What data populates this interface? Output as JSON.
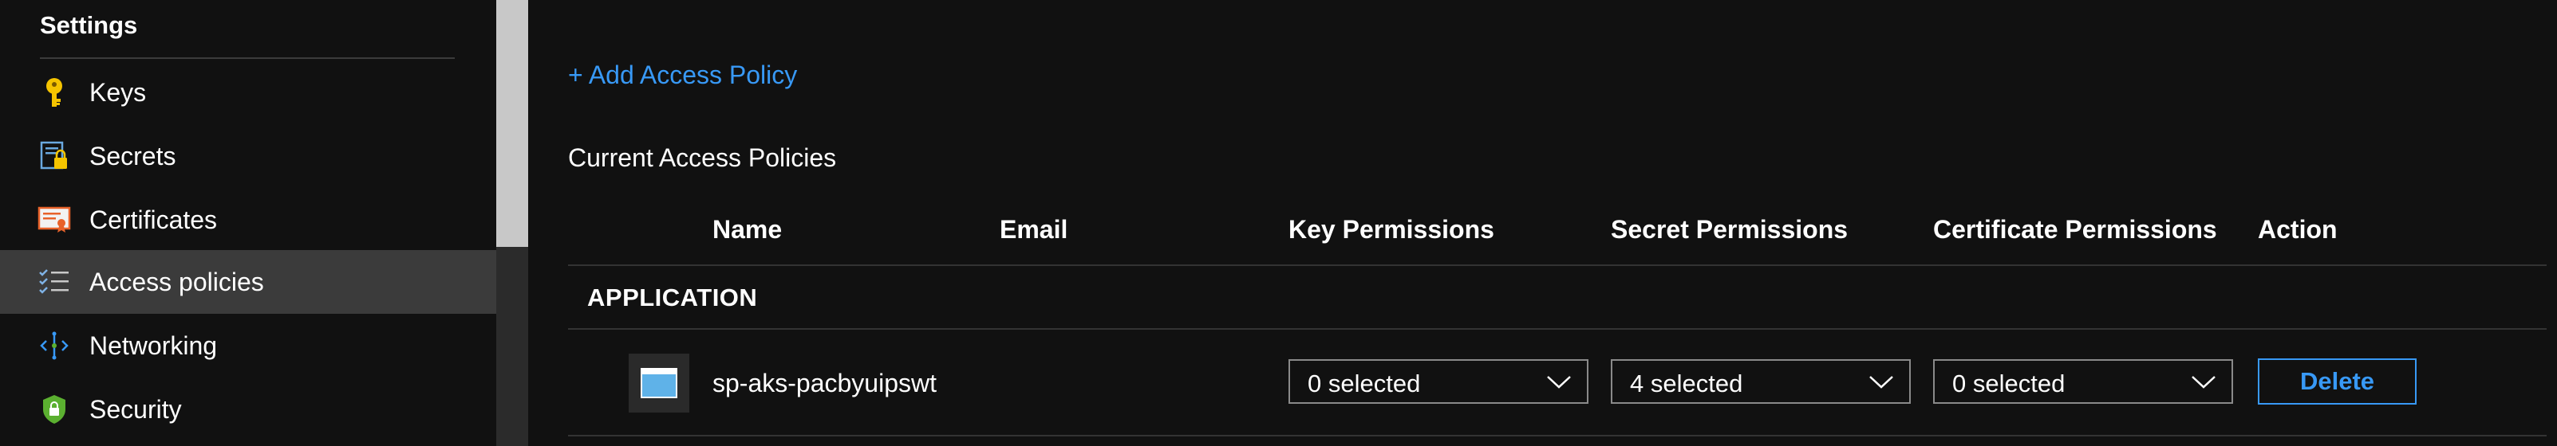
{
  "sidebar": {
    "title": "Settings",
    "items": [
      {
        "label": "Keys",
        "icon": "key-icon"
      },
      {
        "label": "Secrets",
        "icon": "secret-icon"
      },
      {
        "label": "Certificates",
        "icon": "certificate-icon"
      },
      {
        "label": "Access policies",
        "icon": "access-policies-icon",
        "active": true
      },
      {
        "label": "Networking",
        "icon": "networking-icon"
      },
      {
        "label": "Security",
        "icon": "security-shield-icon"
      }
    ]
  },
  "main": {
    "add_link": "+ Add Access Policy",
    "section_title": "Current Access Policies",
    "columns": [
      "Name",
      "Email",
      "Key Permissions",
      "Secret Permissions",
      "Certificate Permissions",
      "Action"
    ],
    "group_label": "APPLICATION",
    "rows": [
      {
        "name": "sp-aks-pacbyuipswt",
        "email": "",
        "key_permissions": "0 selected",
        "secret_permissions": "4 selected",
        "certificate_permissions": "0 selected",
        "action": "Delete"
      }
    ]
  },
  "colors": {
    "background": "#111111",
    "accent": "#3899f6",
    "active_item": "#3b3b3b",
    "key_yellow": "#f5c400",
    "shield_green": "#5bb030"
  }
}
